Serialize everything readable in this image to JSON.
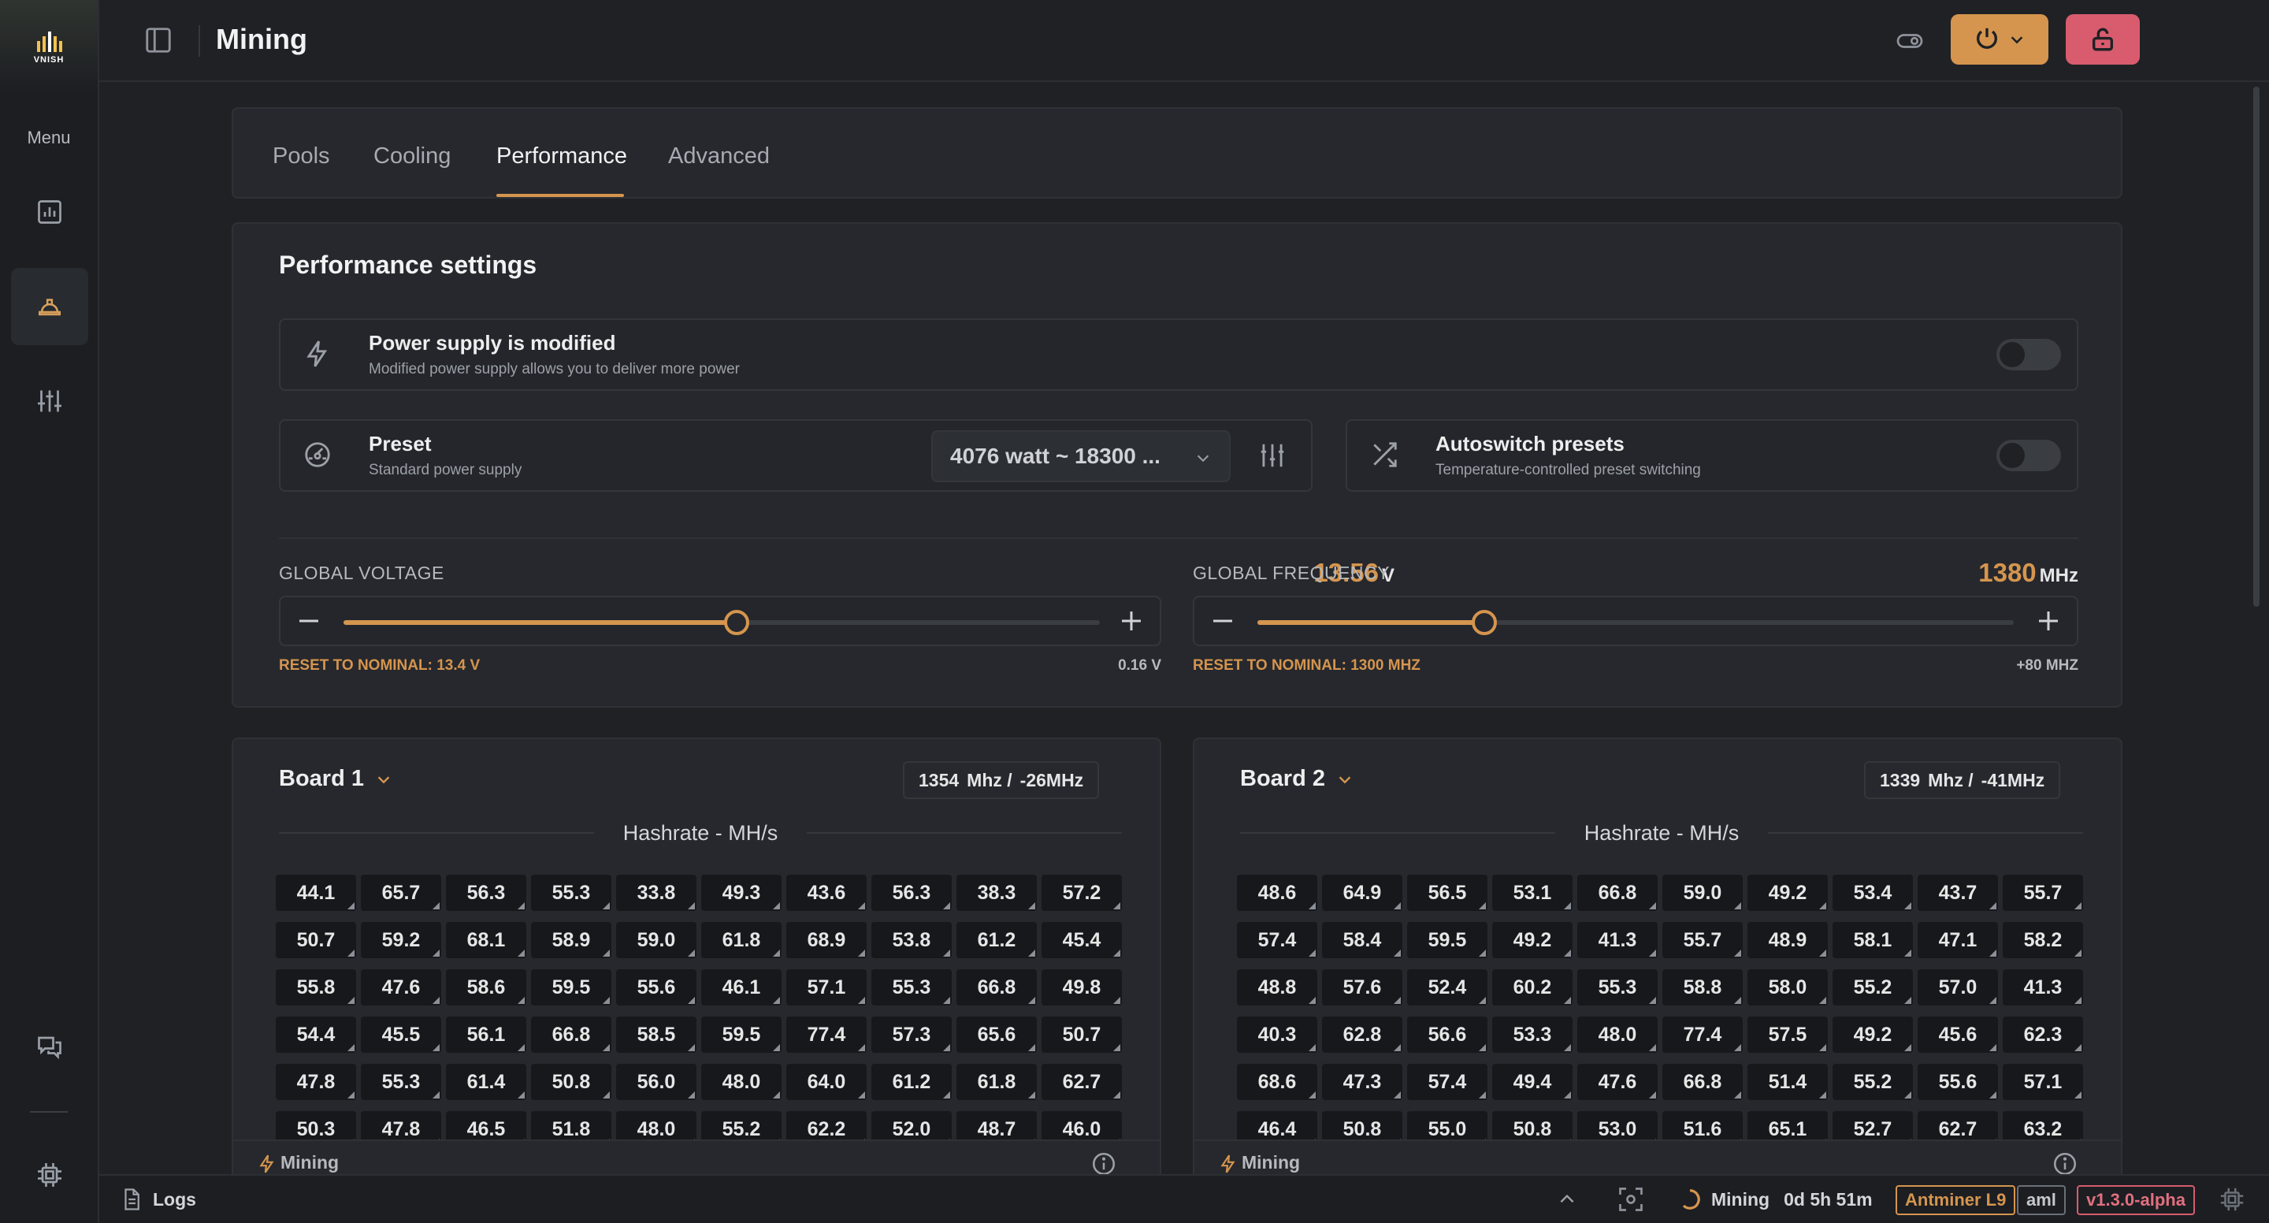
{
  "brand": {
    "name": "VNISH"
  },
  "sidebar": {
    "menu_label": "Menu",
    "items": [
      {
        "name": "dashboard",
        "icon": "bar-chart-icon"
      },
      {
        "name": "mining",
        "icon": "hard-hat-icon",
        "active": true
      },
      {
        "name": "settings",
        "icon": "sliders-icon"
      },
      {
        "name": "support",
        "icon": "chat-icon"
      },
      {
        "name": "system",
        "icon": "chip-icon"
      }
    ]
  },
  "header": {
    "title": "Mining"
  },
  "tabs": [
    {
      "label": "Pools"
    },
    {
      "label": "Cooling"
    },
    {
      "label": "Performance",
      "active": true
    },
    {
      "label": "Advanced"
    }
  ],
  "performance": {
    "title": "Performance settings",
    "power_supply": {
      "title": "Power supply is modified",
      "subtitle": "Modified power supply allows you to deliver more power",
      "enabled": false
    },
    "preset": {
      "title": "Preset",
      "subtitle": "Standard power supply",
      "selected": "4076 watt ~ 18300 ..."
    },
    "autoswitch": {
      "title": "Autoswitch presets",
      "subtitle": "Temperature-controlled preset switching",
      "enabled": false
    },
    "voltage": {
      "label": "GLOBAL VOLTAGE",
      "value": "13.56",
      "unit": "V",
      "reset": "RESET TO NOMINAL: 13.4 V",
      "offset": "0.16 V",
      "fraction": 0.52
    },
    "frequency": {
      "label": "GLOBAL FREQUENCY",
      "value": "1380",
      "unit": "MHz",
      "reset": "RESET TO NOMINAL: 1300 MHZ",
      "offset": "+80 MHZ",
      "fraction": 0.3
    }
  },
  "boards": [
    {
      "title": "Board 1",
      "freq": "1354",
      "freq_unit": "Mhz /",
      "freq_delta": "-26MHz",
      "hash_title": "Hashrate - MH/s",
      "status": "Mining",
      "chips": [
        [
          "44.1",
          "65.7",
          "56.3",
          "55.3",
          "33.8",
          "49.3",
          "43.6",
          "56.3",
          "38.3",
          "57.2"
        ],
        [
          "50.7",
          "59.2",
          "68.1",
          "58.9",
          "59.0",
          "61.8",
          "68.9",
          "53.8",
          "61.2",
          "45.4"
        ],
        [
          "55.8",
          "47.6",
          "58.6",
          "59.5",
          "55.6",
          "46.1",
          "57.1",
          "55.3",
          "66.8",
          "49.8"
        ],
        [
          "54.4",
          "45.5",
          "56.1",
          "66.8",
          "58.5",
          "59.5",
          "77.4",
          "57.3",
          "65.6",
          "50.7"
        ],
        [
          "47.8",
          "55.3",
          "61.4",
          "50.8",
          "56.0",
          "48.0",
          "64.0",
          "61.2",
          "61.8",
          "62.7"
        ],
        [
          "50.3",
          "47.8",
          "46.5",
          "51.8",
          "48.0",
          "55.2",
          "62.2",
          "52.0",
          "48.7",
          "46.0"
        ]
      ]
    },
    {
      "title": "Board 2",
      "freq": "1339",
      "freq_unit": "Mhz /",
      "freq_delta": "-41MHz",
      "hash_title": "Hashrate - MH/s",
      "status": "Mining",
      "chips": [
        [
          "48.6",
          "64.9",
          "56.5",
          "53.1",
          "66.8",
          "59.0",
          "49.2",
          "53.4",
          "43.7",
          "55.7"
        ],
        [
          "57.4",
          "58.4",
          "59.5",
          "49.2",
          "41.3",
          "55.7",
          "48.9",
          "58.1",
          "47.1",
          "58.2"
        ],
        [
          "48.8",
          "57.6",
          "52.4",
          "60.2",
          "55.3",
          "58.8",
          "58.0",
          "55.2",
          "57.0",
          "41.3"
        ],
        [
          "40.3",
          "62.8",
          "56.6",
          "53.3",
          "48.0",
          "77.4",
          "57.5",
          "49.2",
          "45.6",
          "62.3"
        ],
        [
          "68.6",
          "47.3",
          "57.4",
          "49.4",
          "47.6",
          "66.8",
          "51.4",
          "55.2",
          "55.6",
          "57.1"
        ],
        [
          "46.4",
          "50.8",
          "55.0",
          "50.8",
          "53.0",
          "51.6",
          "65.1",
          "52.7",
          "62.7",
          "63.2"
        ]
      ]
    }
  ],
  "statusbar": {
    "logs": "Logs",
    "state": "Mining",
    "uptime": "0d 5h 51m",
    "model": "Antminer L9",
    "tag": "aml",
    "version": "v1.3.0-alpha"
  },
  "colors": {
    "accent": "#d5954e",
    "danger": "#d85c6e",
    "background": "#1f2125",
    "card": "#26282d"
  }
}
